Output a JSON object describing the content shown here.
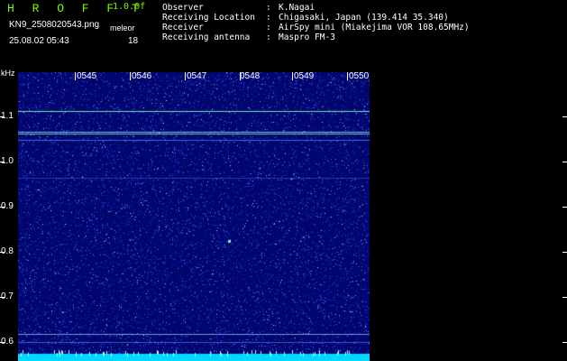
{
  "header": {
    "app_title": "H R O F F T",
    "version": "1.0.0f",
    "filename": "KN9_2508020543.png",
    "meteor_label": "meleor",
    "timestamp": "25.08.02 05:43",
    "meteor_count": "18"
  },
  "metadata": [
    {
      "key": "Observer",
      "sep": ":",
      "value": "K.Nagai"
    },
    {
      "key": "Receiving Location",
      "sep": ":",
      "value": "Chigasaki, Japan (139.414 35.340)"
    },
    {
      "key": "Receiver",
      "sep": ":",
      "value": "AirSpy mini (Miakejima VOR 108.65MHz)"
    },
    {
      "key": "Receiving antenna",
      "sep": ":",
      "value": "Maspro FM-3"
    }
  ],
  "axis": {
    "unit": "kHz",
    "y_labels": [
      "1.1",
      "1.0",
      "0.9",
      "0.8",
      "0.7",
      "0.6"
    ],
    "time_labels": [
      "0545",
      "0546",
      "0547",
      "0548",
      "0549",
      "0550"
    ]
  },
  "colors": {
    "background": "#000000",
    "spectrogram_base": "#03056e",
    "noise": "#3a78ff",
    "signal_line": "#7dffb0",
    "bottom_band": "#00d8ff",
    "title_green": "#7cfc00"
  }
}
